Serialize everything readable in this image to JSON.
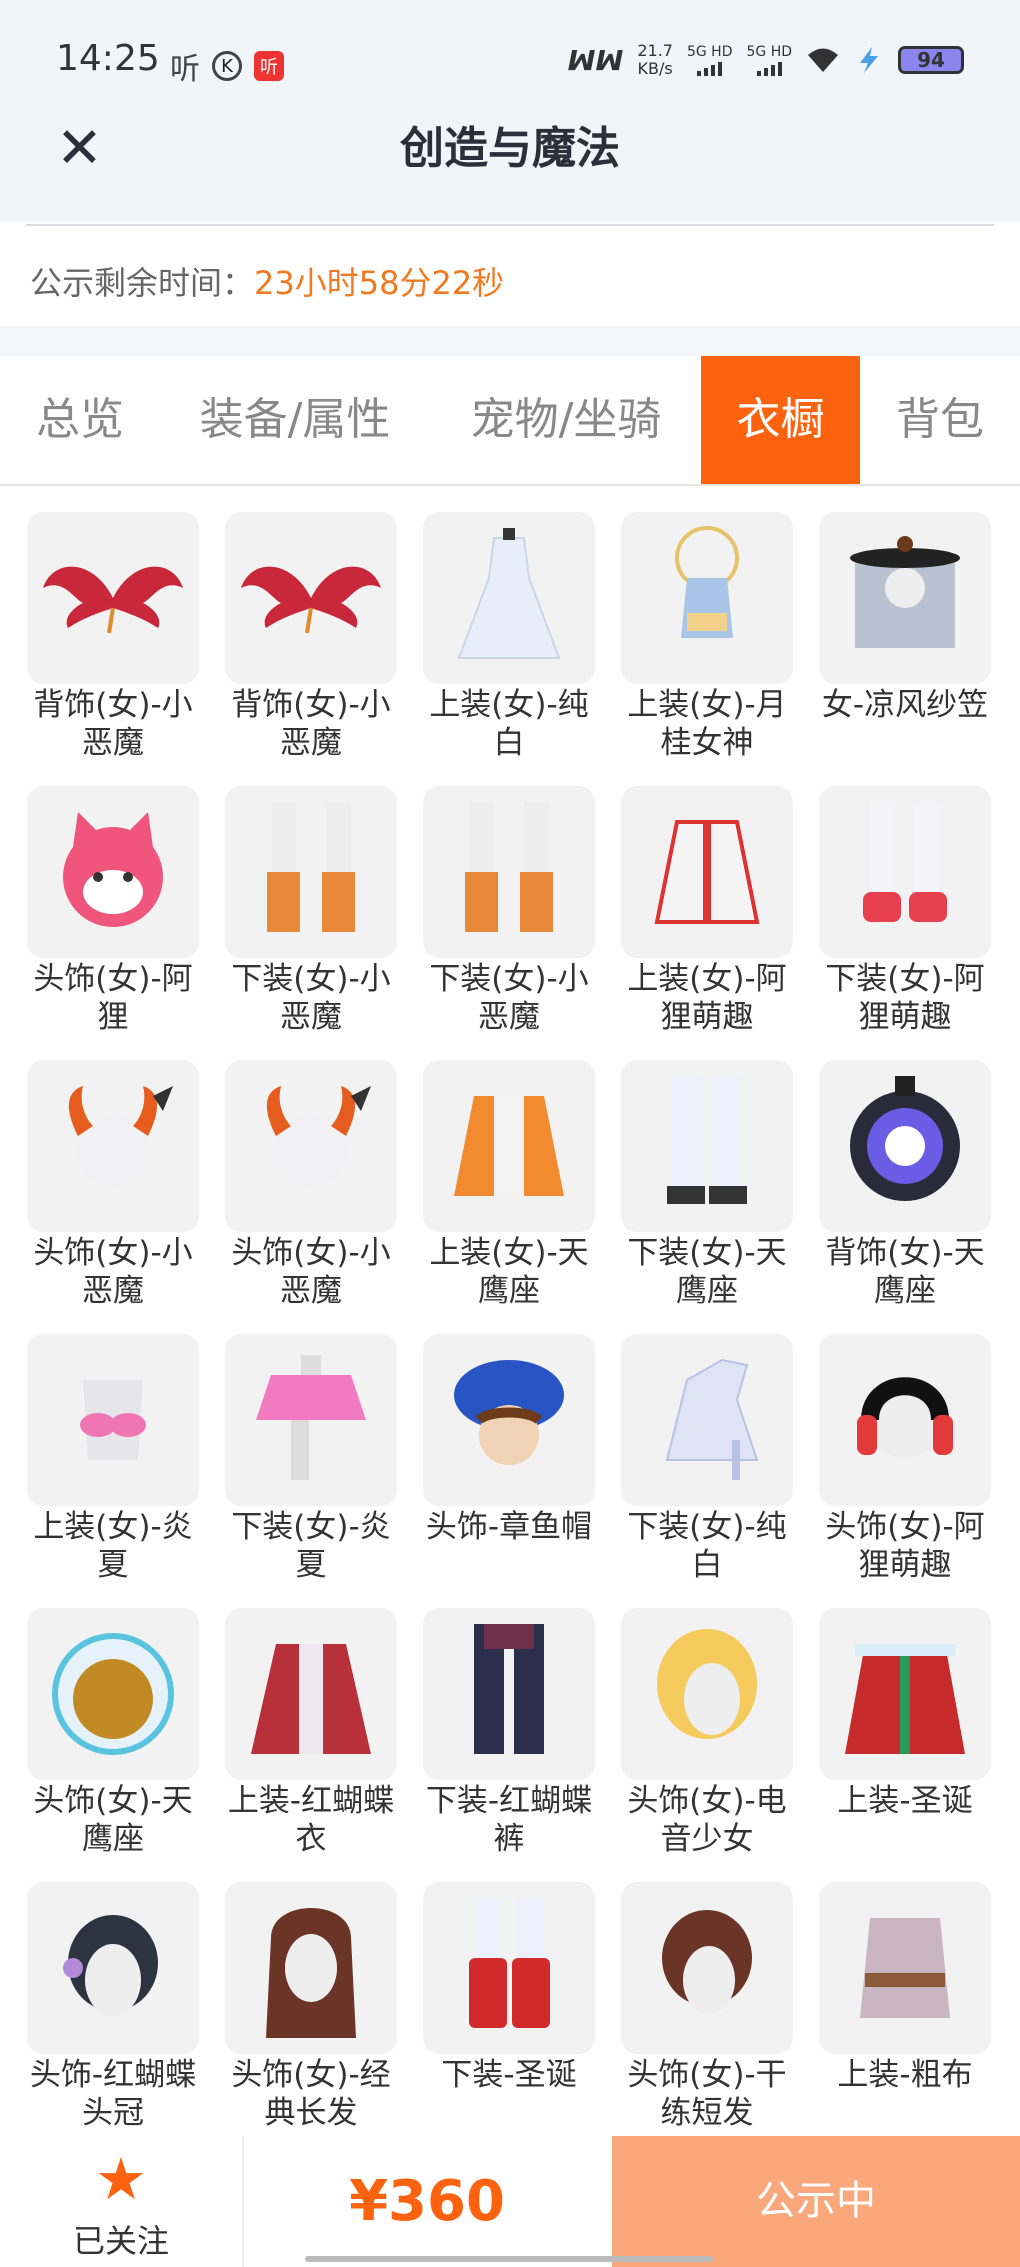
{
  "status_bar": {
    "time": "14:25",
    "notif_ting": "听",
    "notif_k": "K",
    "notif_red": "听",
    "mm": "ꟽꟽ",
    "speed_value": "21.7",
    "speed_unit": "KB/s",
    "sig1": "5G HD",
    "sig2": "5G HD",
    "battery": "94"
  },
  "header": {
    "close_symbol": "✕",
    "title": "创造与魔法"
  },
  "countdown": {
    "label": "公示剩余时间：",
    "value": "23小时58分22秒"
  },
  "tabs": [
    {
      "label": "总览"
    },
    {
      "label": "装备/属性"
    },
    {
      "label": "宠物/坐骑"
    },
    {
      "label": "衣橱"
    },
    {
      "label": "背包"
    }
  ],
  "active_tab": "衣橱",
  "items": [
    {
      "name": "背饰(女)-小恶魔",
      "icon": "devil-wings-icon"
    },
    {
      "name": "背饰(女)-小恶魔",
      "icon": "devil-wings-icon"
    },
    {
      "name": "上装(女)-纯白",
      "icon": "white-dress-icon"
    },
    {
      "name": "上装(女)-月桂女神",
      "icon": "laurel-goddess-top-icon"
    },
    {
      "name": "女-凉风纱笠",
      "icon": "veil-hat-icon"
    },
    {
      "name": "头饰(女)-阿狸",
      "icon": "ali-fox-head-icon"
    },
    {
      "name": "下装(女)-小恶魔",
      "icon": "devil-boots-icon"
    },
    {
      "name": "下装(女)-小恶魔",
      "icon": "devil-boots-icon"
    },
    {
      "name": "上装(女)-阿狸萌趣",
      "icon": "ali-hoodie-icon"
    },
    {
      "name": "下装(女)-阿狸萌趣",
      "icon": "ali-sneakers-icon"
    },
    {
      "name": "头饰(女)-小恶魔",
      "icon": "devil-horns-head-icon"
    },
    {
      "name": "头饰(女)-小恶魔",
      "icon": "devil-horns-head-icon"
    },
    {
      "name": "上装(女)-天鹰座",
      "icon": "aquila-jacket-icon"
    },
    {
      "name": "下装(女)-天鹰座",
      "icon": "aquila-pants-icon"
    },
    {
      "name": "背饰(女)-天鹰座",
      "icon": "aquila-backpack-icon"
    },
    {
      "name": "上装(女)-炎夏",
      "icon": "summer-bikini-top-icon"
    },
    {
      "name": "下装(女)-炎夏",
      "icon": "summer-skirt-icon"
    },
    {
      "name": "头饰-章鱼帽",
      "icon": "octopus-hat-icon"
    },
    {
      "name": "下装(女)-纯白",
      "icon": "white-heels-icon"
    },
    {
      "name": "头饰(女)-阿狸萌趣",
      "icon": "ali-headphones-icon"
    },
    {
      "name": "头饰(女)-天鹰座",
      "icon": "aquila-helmet-icon"
    },
    {
      "name": "上装-红蝴蝶衣",
      "icon": "red-butterfly-coat-icon"
    },
    {
      "name": "下装-红蝴蝶裤",
      "icon": "red-butterfly-pants-icon"
    },
    {
      "name": "头饰(女)-电音少女",
      "icon": "blonde-hair-icon"
    },
    {
      "name": "上装-圣诞",
      "icon": "christmas-coat-icon"
    },
    {
      "name": "头饰-红蝴蝶头冠",
      "icon": "butterfly-crown-hair-icon"
    },
    {
      "name": "头饰(女)-经典长发",
      "icon": "long-hair-icon"
    },
    {
      "name": "下装-圣诞",
      "icon": "christmas-boots-icon"
    },
    {
      "name": "头饰(女)-干练短发",
      "icon": "short-hair-icon"
    },
    {
      "name": "上装-粗布",
      "icon": "coarse-cloth-shirt-icon"
    }
  ],
  "bottom": {
    "follow_icon": "star-icon",
    "follow_symbol": "★",
    "follow_label": "已关注",
    "price": "¥360",
    "status_button": "公示中"
  },
  "colors": {
    "accent": "#fd620f",
    "countdown": "#ef7a22",
    "status_button": "#f9a77b"
  }
}
